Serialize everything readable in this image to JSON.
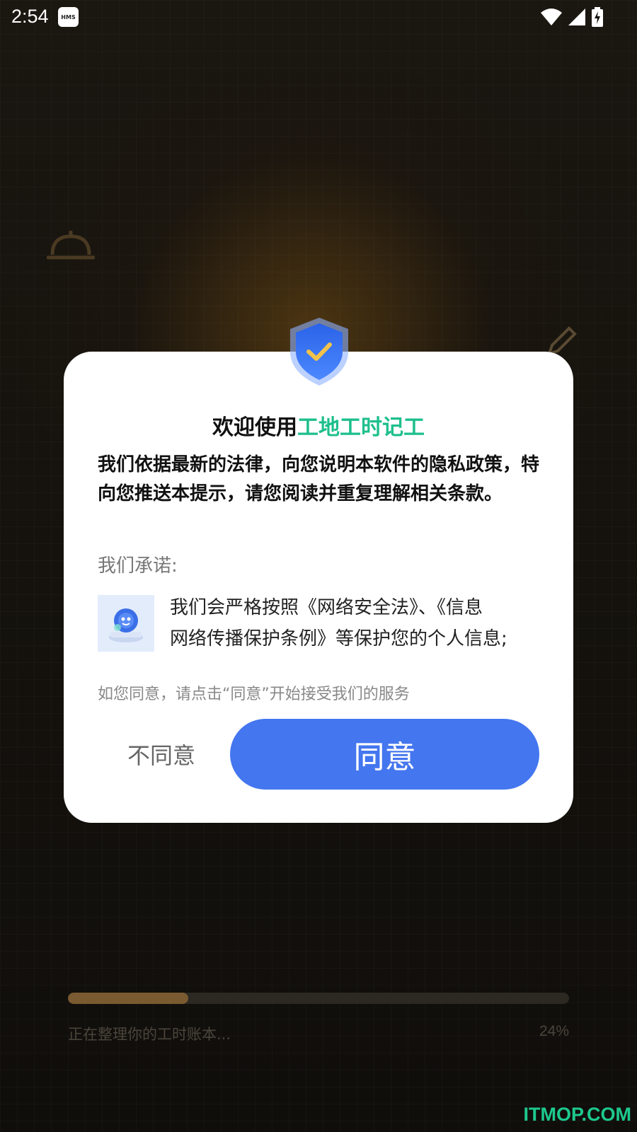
{
  "status_bar": {
    "time": "2:54",
    "hms_badge": "HMS",
    "icons": [
      "wifi-icon",
      "signal-icon",
      "battery-charging-icon"
    ]
  },
  "dialog": {
    "title_prefix": "欢迎使用",
    "title_app_name": "工地工时记工",
    "intro": "我们依据最新的法律，向您说明本软件的隐私政策，特向您推送本提示，请您阅读并重复理解相关条款。",
    "promise_label": "我们承诺:",
    "promise_line1": "我们会严格按照《网络安全法》、《信息",
    "promise_line2": "网络传播保护条例》等保护您的个人信息;",
    "hint": "如您同意，请点击“同意”开始接受我们的服务",
    "disagree_label": "不同意",
    "agree_label": "同意"
  },
  "loading": {
    "label": "正在整理你的工时账本...",
    "percent_text": "24%",
    "progress": 0.24
  },
  "watermark": "ITMOP.COM",
  "colors": {
    "accent_green": "#1dbf8c",
    "agree_button": "#4476ef",
    "progress_fill": "#7a5a30"
  }
}
